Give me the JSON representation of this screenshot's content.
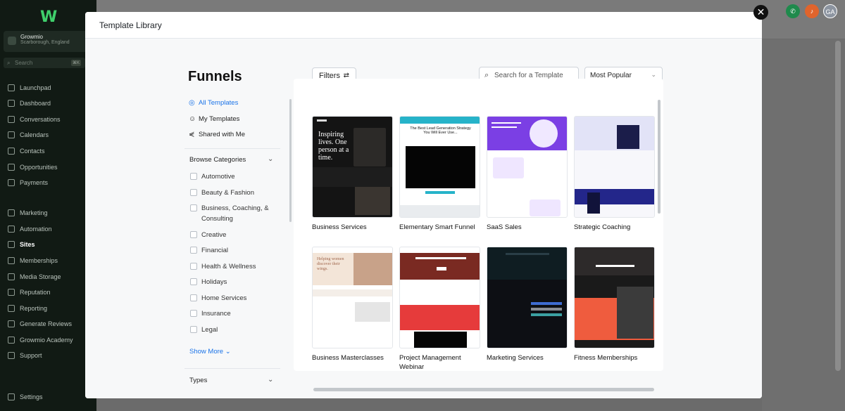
{
  "sidebar": {
    "account": {
      "name": "Growmio",
      "location": "Scarborough, England"
    },
    "search": {
      "placeholder": "Search",
      "shortcut": "⌘K"
    },
    "items": [
      {
        "label": "Launchpad"
      },
      {
        "label": "Dashboard"
      },
      {
        "label": "Conversations"
      },
      {
        "label": "Calendars"
      },
      {
        "label": "Contacts"
      },
      {
        "label": "Opportunities"
      },
      {
        "label": "Payments"
      },
      {
        "label": "Marketing"
      },
      {
        "label": "Automation"
      },
      {
        "label": "Sites"
      },
      {
        "label": "Memberships"
      },
      {
        "label": "Media Storage"
      },
      {
        "label": "Reputation"
      },
      {
        "label": "Reporting"
      },
      {
        "label": "Generate Reviews"
      },
      {
        "label": "Growmio Academy"
      },
      {
        "label": "Support"
      },
      {
        "label": "Settings"
      }
    ]
  },
  "topbar": {
    "avatar_initials": "GA"
  },
  "modal": {
    "title": "Template Library",
    "close_label": "✕",
    "heading": "Funnels",
    "filters_label": "Filters",
    "search_placeholder": "Search for a Template",
    "sort_value": "Most Popular",
    "links": [
      {
        "label": "All Templates"
      },
      {
        "label": "My Templates"
      },
      {
        "label": "Shared with Me"
      }
    ],
    "browse_categories_label": "Browse Categories",
    "categories": [
      {
        "label": "Automotive"
      },
      {
        "label": "Beauty & Fashion"
      },
      {
        "label": "Business, Coaching, & Consulting"
      },
      {
        "label": "Creative"
      },
      {
        "label": "Financial"
      },
      {
        "label": "Health & Wellness"
      },
      {
        "label": "Holidays"
      },
      {
        "label": "Home Services"
      },
      {
        "label": "Insurance"
      },
      {
        "label": "Legal"
      }
    ],
    "show_more_label": "Show More",
    "types_label": "Types",
    "templates": [
      {
        "label": "Business Services",
        "thumb_text": "Inspiring lives. One person at a time."
      },
      {
        "label": "Elementary Smart Funnel",
        "thumb_text": "The Best Lead Generation Strategy You Will Ever Use..."
      },
      {
        "label": "SaaS Sales"
      },
      {
        "label": "Strategic Coaching"
      },
      {
        "label": "Business Masterclasses",
        "thumb_text": "Helping women discover their wings."
      },
      {
        "label": "Project Management Webinar"
      },
      {
        "label": "Marketing Services"
      },
      {
        "label": "Fitness Memberships"
      }
    ]
  }
}
